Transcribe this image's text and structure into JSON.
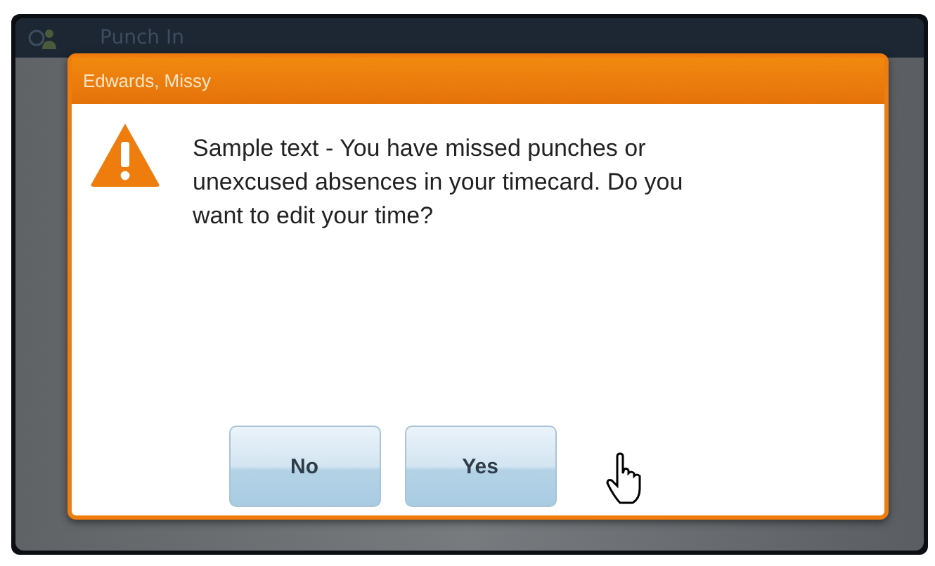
{
  "app": {
    "title": "Punch In"
  },
  "dialog": {
    "title": "Edwards, Missy",
    "message": "Sample text - You have missed punches or unexcused absences in your timecard. Do you want to edit your time?",
    "buttons": [
      {
        "label": "No"
      },
      {
        "label": "Yes"
      }
    ]
  }
}
